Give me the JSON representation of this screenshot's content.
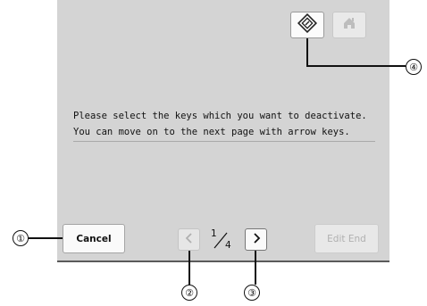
{
  "message": {
    "line1": "Please select the keys which you want to deactivate.",
    "line2": "You can move on to the next page with arrow keys."
  },
  "buttons": {
    "cancel_label": "Cancel",
    "edit_end_label": "Edit End"
  },
  "pagination": {
    "current": "1",
    "total": "4"
  },
  "icons": {
    "lock_icon": "lock-key-icon",
    "home_icon": "home-icon",
    "prev_icon": "chevron-left-icon",
    "next_icon": "chevron-right-icon"
  },
  "callouts": {
    "c1": "①",
    "c2": "②",
    "c3": "③",
    "c4": "④"
  },
  "colors": {
    "screen_bg": "#d4d4d4",
    "button_bg": "#f6f6f6",
    "disabled_text": "#b0b0b0"
  }
}
